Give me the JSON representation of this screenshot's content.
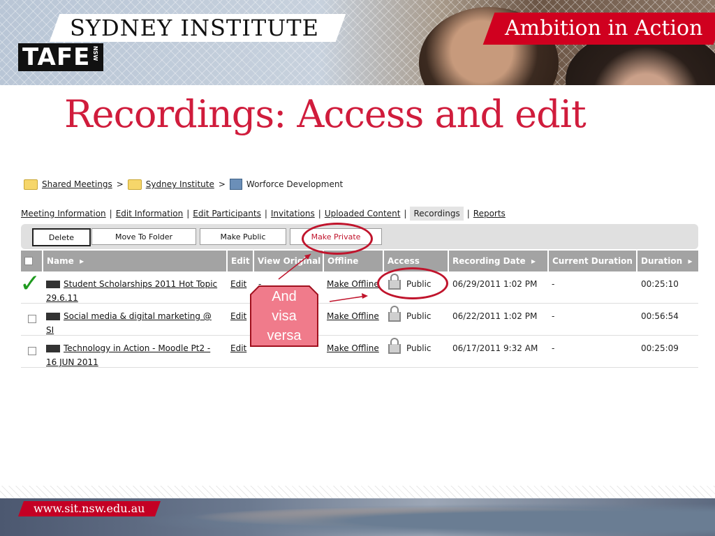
{
  "header": {
    "institute": "SYDNEY INSTITUTE",
    "logo": "TAFE",
    "logo_sub": "NSW",
    "tagline": "Ambition in Action"
  },
  "slide": {
    "title": "Recordings: Access and edit"
  },
  "breadcrumb": {
    "items": [
      "Shared Meetings",
      "Sydney Institute",
      "Worforce Development"
    ],
    "separator": ">"
  },
  "tabs": [
    "Meeting Information",
    "Edit Information",
    "Edit Participants",
    "Invitations",
    "Uploaded Content",
    "Recordings",
    "Reports"
  ],
  "toolbar": [
    "Delete",
    "Move To Folder",
    "Make Public",
    "Make Private"
  ],
  "columns": [
    "Name",
    "Edit",
    "View Original",
    "Offline",
    "Access",
    "Recording Date",
    "Current Duration",
    "Duration"
  ],
  "sort_arrow": "▸",
  "rows": [
    {
      "name1": "Student Scholarships 2011 Hot Topic",
      "name2": "29.6.11",
      "edit": "Edit",
      "view": "-",
      "offline": "Make Offline",
      "access": "Public",
      "date": "06/29/2011 1:02 PM",
      "current": "-",
      "duration": "00:25:10"
    },
    {
      "name1": "Social media & digital marketing @",
      "name2": "SI",
      "edit": "Edit",
      "view": "-",
      "offline": "Make Offline",
      "access": "Public",
      "date": "06/22/2011 1:02 PM",
      "current": "-",
      "duration": "00:56:54"
    },
    {
      "name1": "Technology in Action - Moodle Pt2 -",
      "name2": "16 JUN 2011",
      "edit": "Edit",
      "view": "",
      "offline": "Make Offline",
      "access": "Public",
      "date": "06/17/2011 9:32 AM",
      "current": "-",
      "duration": "00:25:09"
    }
  ],
  "annotation": {
    "callout": [
      "And",
      "visa",
      "versa"
    ],
    "check": "✓"
  },
  "footer": {
    "url": "www.sit.nsw.edu.au"
  },
  "colors": {
    "brand_red": "#d0001f",
    "title_red": "#d01c3c",
    "annotation_red": "#c0142c",
    "callout_fill": "#f07b8b",
    "check_green": "#1f9a1f"
  }
}
